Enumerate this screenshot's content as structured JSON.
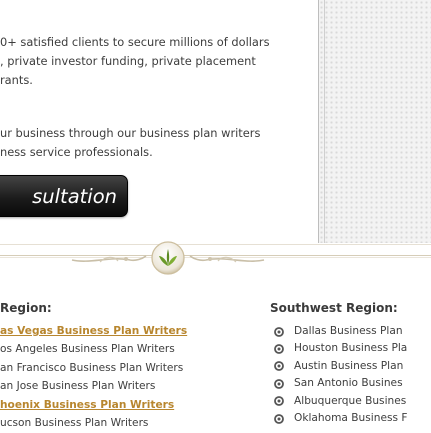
{
  "intro": {
    "paragraph1": [
      "0+ satisfied clients to secure millions of dollars",
      ", private investor funding, private placement",
      "rants."
    ],
    "paragraph2": [
      "ur business through our business plan writers",
      "ness service professionals."
    ]
  },
  "consult_button": {
    "label": "sultation"
  },
  "left_region": {
    "heading": "Region:",
    "items": [
      {
        "label": "as Vegas Business Plan Writers",
        "highlighted": true
      },
      {
        "label": "os Angeles Business Plan Writers",
        "highlighted": false
      },
      {
        "label": "an Francisco Business Plan Writers",
        "highlighted": false
      },
      {
        "label": "an Jose Business Plan Writers",
        "highlighted": false
      },
      {
        "label": "hoenix Business Plan Writers",
        "highlighted": true
      },
      {
        "label": "ucson Business Plan Writers",
        "highlighted": false
      }
    ]
  },
  "right_region": {
    "heading": "Southwest Region:",
    "items": [
      {
        "label": "Dallas Business Plan"
      },
      {
        "label": "Houston Business Pla"
      },
      {
        "label": "Austin Business Plan"
      },
      {
        "label": "San Antonio Busines"
      },
      {
        "label": "Albuquerque Busines"
      },
      {
        "label": "Oklahoma Business F"
      }
    ]
  },
  "colors": {
    "link_highlight": "#b8862e",
    "text": "#3d3d3d",
    "button_bg": "#1c1c1c",
    "emblem_green": "#6a9a2a"
  },
  "icons": {
    "divider": "leaf-emblem-icon",
    "bullet": "circle-bullet-icon"
  }
}
